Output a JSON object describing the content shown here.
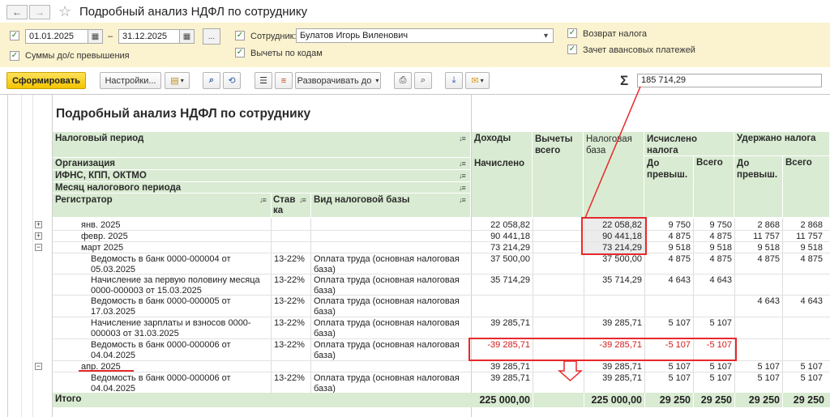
{
  "window": {
    "title": "Подробный анализ НДФЛ по сотруднику",
    "back_icon": "arrow-left-icon",
    "forward_icon": "arrow-right-icon",
    "favorite_icon": "star-icon"
  },
  "filters": {
    "period_from": "01.01.2025",
    "period_dash": "–",
    "period_to": "31.12.2025",
    "period_more": "...",
    "employee_label": "Сотрудник:",
    "employee_value": "Булатов Игорь Виленович",
    "sums_label": "Суммы до/с превышения",
    "deductions_label": "Вычеты по кодам",
    "refund_label": "Возврат налога",
    "advance_label": "Зачет авансовых платежей"
  },
  "toolbar": {
    "generate": "Сформировать",
    "settings": "Настройки...",
    "expand": "Разворачивать до",
    "sigma": "Σ",
    "sum_value": "185 714,29"
  },
  "report": {
    "title": "Подробный анализ НДФЛ по сотруднику",
    "headers": {
      "period": "Налоговый период",
      "org": "Организация",
      "ifns": "ИФНС, КПП, ОКТМО",
      "month": "Месяц налогового периода",
      "registrar": "Регистратор",
      "rate": "Ставка",
      "base_kind": "Вид налоговой базы",
      "income": "Доходы",
      "accrued": "Начислено",
      "deductions": "Вычеты всего",
      "tax_base": "Налоговая база",
      "calculated": "Исчислено налога",
      "withheld": "Удержано налога",
      "before_excess": "До превыш.",
      "total": "Всего"
    },
    "rows": [
      {
        "kind": "month",
        "label": "янв. 2025",
        "income": "22 058,82",
        "deductions": "",
        "base": "22 058,82",
        "calc_before": "9 750",
        "calc_total": "9 750",
        "wh_before": "2 868",
        "wh_total": "2 868"
      },
      {
        "kind": "month",
        "label": "февр. 2025",
        "income": "90 441,18",
        "deductions": "",
        "base": "90 441,18",
        "calc_before": "4 875",
        "calc_total": "4 875",
        "wh_before": "11 757",
        "wh_total": "11 757"
      },
      {
        "kind": "month",
        "label": "март 2025",
        "income": "73 214,29",
        "deductions": "",
        "base": "73 214,29",
        "calc_before": "9 518",
        "calc_total": "9 518",
        "wh_before": "9 518",
        "wh_total": "9 518"
      },
      {
        "kind": "doc",
        "label": "Ведомость в банк 0000-000004 от 05.03.2025",
        "rate": "13-22%",
        "base_kind": "Оплата труда (основная налоговая база)",
        "income": "37 500,00",
        "base": "37 500,00",
        "calc_before": "4 875",
        "calc_total": "4 875",
        "wh_before": "4 875",
        "wh_total": "4 875"
      },
      {
        "kind": "doc",
        "label": "Начисление за первую половину месяца 0000-000003 от 15.03.2025",
        "rate": "13-22%",
        "base_kind": "Оплата труда (основная налоговая база)",
        "income": "35 714,29",
        "base": "35 714,29",
        "calc_before": "4 643",
        "calc_total": "4 643",
        "wh_before": "",
        "wh_total": ""
      },
      {
        "kind": "doc",
        "label": "Ведомость в банк 0000-000005 от 17.03.2025",
        "rate": "13-22%",
        "base_kind": "Оплата труда (основная налоговая база)",
        "income": "",
        "base": "",
        "calc_before": "",
        "calc_total": "",
        "wh_before": "4 643",
        "wh_total": "4 643"
      },
      {
        "kind": "doc",
        "label": "Начисление зарплаты и взносов 0000-000003 от 31.03.2025",
        "rate": "13-22%",
        "base_kind": "Оплата труда (основная налоговая база)",
        "income": "39 285,71",
        "base": "39 285,71",
        "calc_before": "5 107",
        "calc_total": "5 107",
        "wh_before": "",
        "wh_total": ""
      },
      {
        "kind": "doc",
        "label": "Ведомость в банк 0000-000006 от 04.04.2025",
        "rate": "13-22%",
        "base_kind": "Оплата труда (основная налоговая база)",
        "income": "-39 285,71",
        "base": "-39 285,71",
        "calc_before": "-5 107",
        "calc_total": "-5 107",
        "wh_before": "",
        "wh_total": ""
      },
      {
        "kind": "month",
        "label": "апр. 2025",
        "income": "39 285,71",
        "base": "39 285,71",
        "calc_before": "5 107",
        "calc_total": "5 107",
        "wh_before": "5 107",
        "wh_total": "5 107"
      },
      {
        "kind": "doc",
        "label": "Ведомость в банк 0000-000006 от 04.04.2025",
        "rate": "13-22%",
        "base_kind": "Оплата труда (основная налоговая база)",
        "income": "39 285,71",
        "base": "39 285,71",
        "calc_before": "5 107",
        "calc_total": "5 107",
        "wh_before": "5 107",
        "wh_total": "5 107"
      }
    ],
    "totals": {
      "label": "Итого",
      "income": "225 000,00",
      "base": "225 000,00",
      "calc_before": "29 250",
      "calc_total": "29 250",
      "wh_before": "29 250",
      "wh_total": "29 250"
    }
  },
  "colors": {
    "header_green": "#d9ebd2",
    "filter_yellow": "#fbf3cf",
    "highlight_red": "#e8282b",
    "negative_red": "#d11a1a"
  }
}
